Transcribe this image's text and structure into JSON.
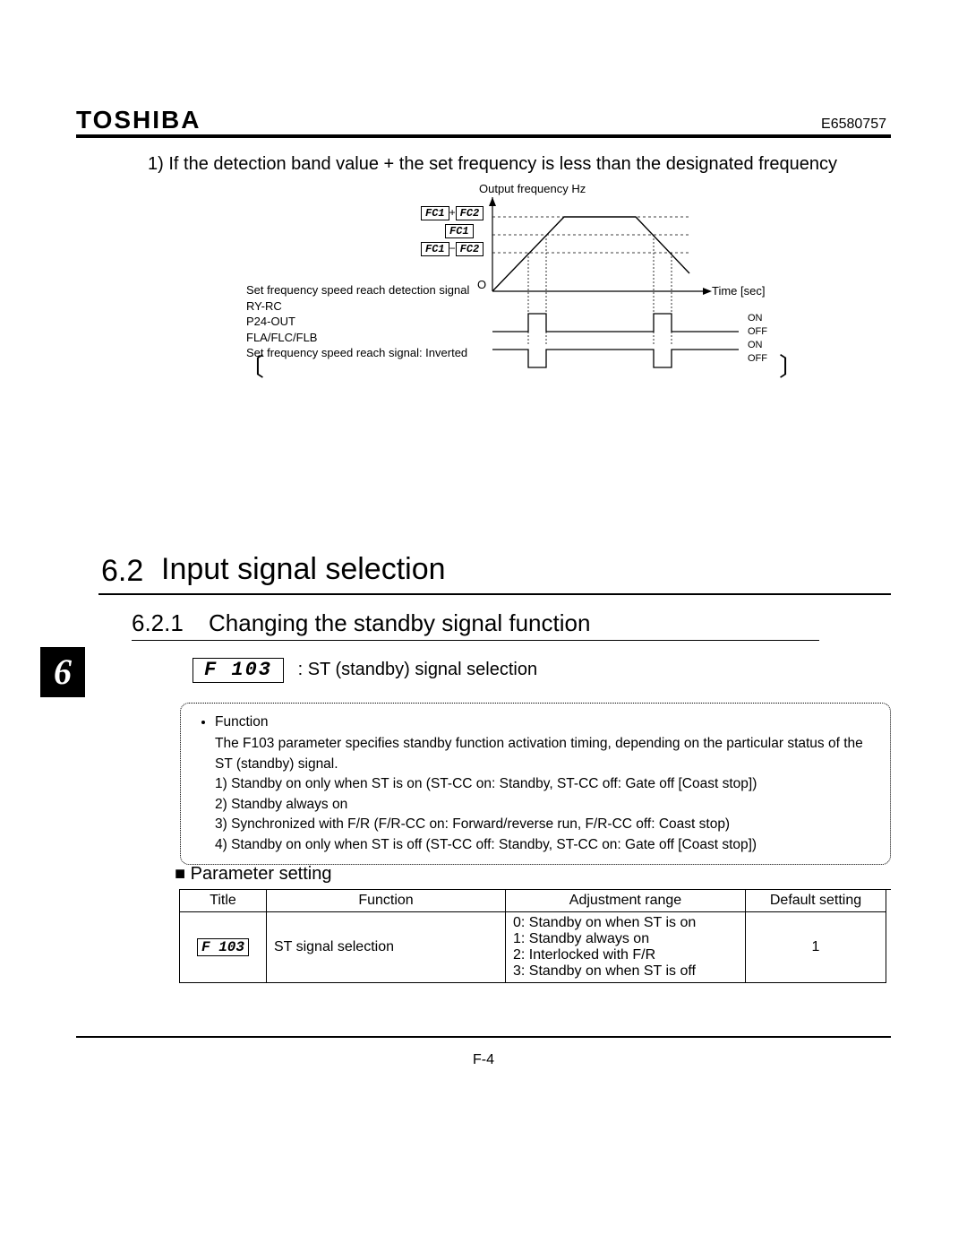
{
  "header": {
    "brand": "TOSHIBA",
    "docnum": "E6580757"
  },
  "intro": {
    "item_no": "1)",
    "text": "If the detection band value + the set frequency is less than the designated frequency"
  },
  "chart_data": {
    "type": "line",
    "title": "Output frequency Hz",
    "xlabel": "Time [sec]",
    "ylabel": "Output frequency Hz",
    "y_levels": [
      "FC1+FC2",
      "FC1",
      "FC1−FC2"
    ],
    "signals": {
      "first": {
        "labels": [
          "ON",
          "OFF"
        ]
      },
      "second_inverted": {
        "labels": [
          "ON",
          "OFF"
        ]
      }
    },
    "left_labels": {
      "l1": "Set frequency speed reach detection signal",
      "l2": "RY-RC",
      "l3": "P24-OUT",
      "l4": "FLA/FLC/FLB",
      "l5": "Set frequency speed reach signal: Inverted"
    }
  },
  "section": {
    "num": "6.2",
    "title": "Input signal selection"
  },
  "subsection": {
    "num": "6.2.1",
    "title": "Changing the standby signal function"
  },
  "chapter_tab": "6",
  "param_code": {
    "code": "F 103",
    "label": ": ST (standby) signal selection"
  },
  "function_box": {
    "heading": "Function",
    "body": "The F103 parameter specifies standby function activation timing, depending on the particular status of the ST (standby) signal.",
    "items": {
      "i1": "1)  Standby on only when ST is on (ST-CC on: Standby, ST-CC off: Gate off [Coast stop])",
      "i2": "2)  Standby always on",
      "i3": "3)  Synchronized with F/R (F/R-CC on: Forward/reverse run, F/R-CC off: Coast stop)",
      "i4": "4)  Standby on only when ST is off (ST-CC off: Standby, ST-CC on: Gate off [Coast stop])"
    }
  },
  "param_setting": {
    "heading": "■  Parameter setting",
    "table": {
      "headers": {
        "h1": "Title",
        "h2": "Function",
        "h3": "Adjustment range",
        "h4": "Default setting"
      },
      "row": {
        "title": "F 103",
        "function": "ST signal selection",
        "range": {
          "r0": "0: Standby on when ST is on",
          "r1": "1: Standby always on",
          "r2": "2: Interlocked with F/R",
          "r3": "3: Standby on when ST is off"
        },
        "default": "1"
      }
    }
  },
  "footer": {
    "page": "F-4"
  }
}
